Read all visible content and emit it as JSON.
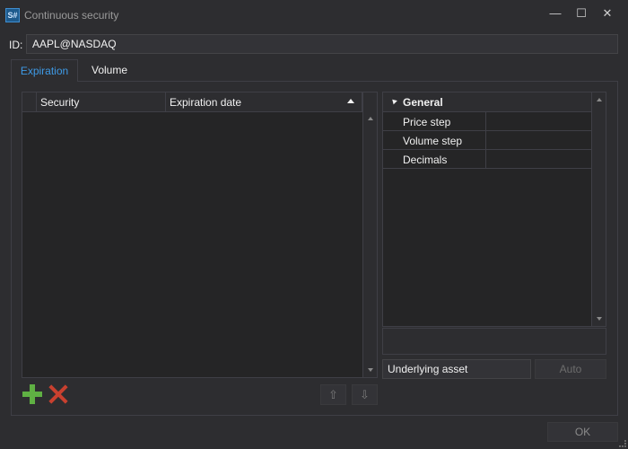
{
  "window": {
    "title": "Continuous security",
    "logo_text": "S#",
    "minimize": "—",
    "maximize": "☐",
    "close": "✕"
  },
  "id_row": {
    "label": "ID:",
    "value": "AAPL@NASDAQ"
  },
  "tabs": [
    {
      "label": "Expiration",
      "active": true
    },
    {
      "label": "Volume",
      "active": false
    }
  ],
  "grid": {
    "columns": [
      "Security",
      "Expiration date"
    ],
    "rows": [],
    "sort": "ascending"
  },
  "properties": {
    "category": "General",
    "items": [
      {
        "name": "Price step",
        "value": ""
      },
      {
        "name": "Volume step",
        "value": ""
      },
      {
        "name": "Decimals",
        "value": ""
      }
    ]
  },
  "underlying": {
    "value": "Underlying asset",
    "auto_label": "Auto"
  },
  "actions": {
    "move_up": "⇧",
    "move_down": "⇩"
  },
  "footer": {
    "ok_label": "OK"
  },
  "colors": {
    "background": "#2d2d30",
    "accent": "#3e9ae6",
    "add": "#5fb043",
    "remove": "#c8402f"
  }
}
